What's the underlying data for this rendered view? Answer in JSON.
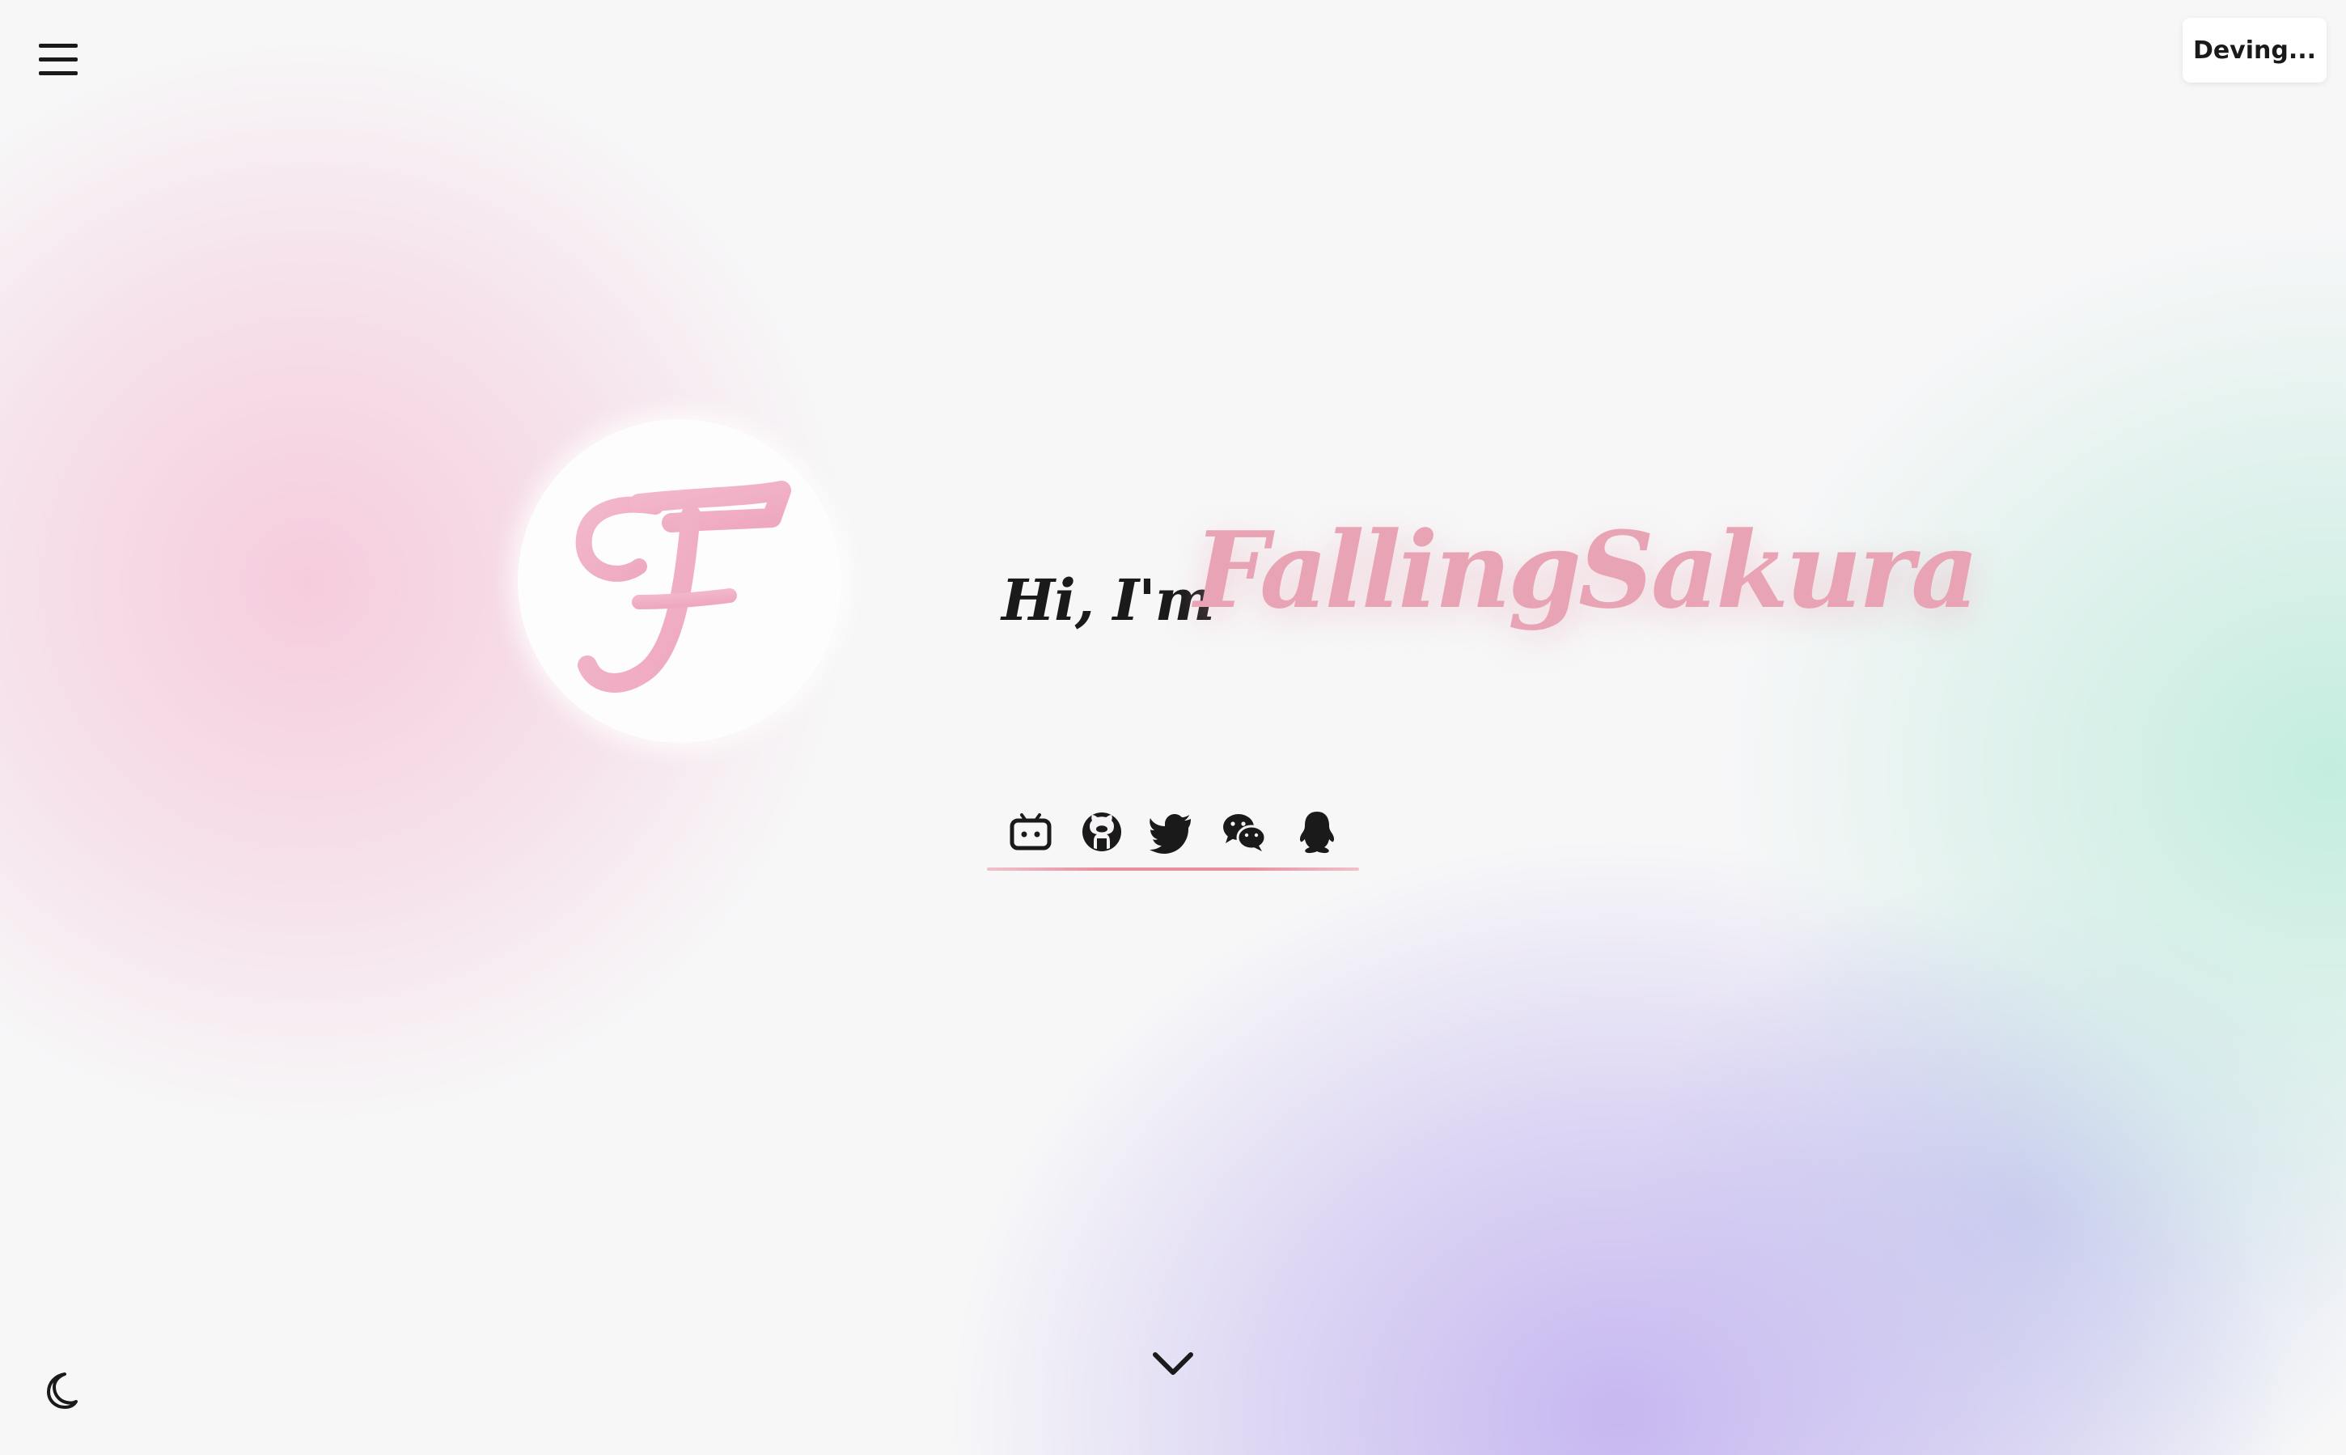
{
  "header": {
    "menu_icon": "hamburger-menu-icon",
    "status_label": "Deving..."
  },
  "hero": {
    "avatar_letter": "F",
    "greeting_prefix": "Hi, I'm",
    "name": "FallingSakura",
    "accent_color": "#e8a3b4"
  },
  "socials": {
    "items": [
      {
        "name": "bilibili",
        "icon": "bilibili-icon"
      },
      {
        "name": "github",
        "icon": "github-icon"
      },
      {
        "name": "twitter",
        "icon": "twitter-icon"
      },
      {
        "name": "wechat",
        "icon": "wechat-icon"
      },
      {
        "name": "qq",
        "icon": "qq-icon"
      }
    ],
    "underline_color": "#e8909f"
  },
  "footer": {
    "scroll_icon": "chevron-down-icon",
    "theme_icon": "moon-icon"
  }
}
